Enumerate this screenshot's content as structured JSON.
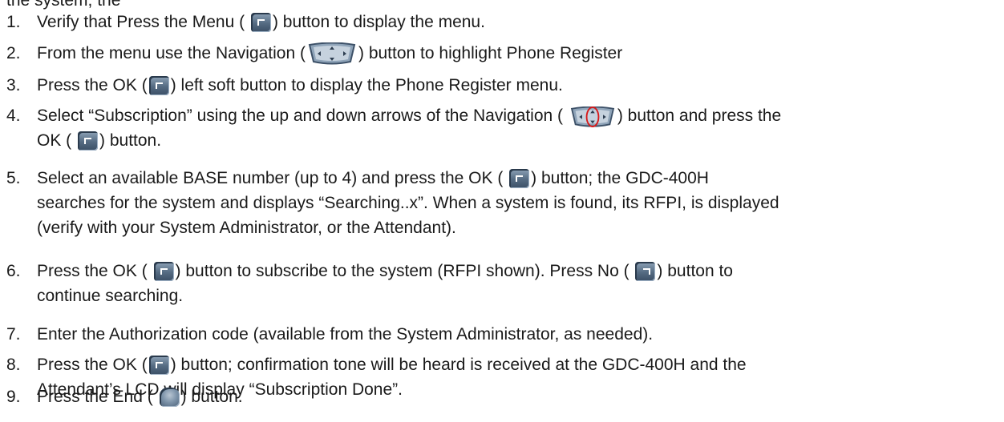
{
  "top_fragment": "the system, the",
  "steps": [
    {
      "num": "1.",
      "lines": [
        [
          {
            "t": "Verify that Press the Menu ( "
          },
          {
            "icon": "menu-key-icon"
          },
          {
            "t": ") button to display the menu."
          }
        ]
      ]
    },
    {
      "num": "2.",
      "lines": [
        [
          {
            "t": "From the menu use the Navigation ("
          },
          {
            "icon": "navigation-key-icon"
          },
          {
            "t": ") button to highlight Phone Register"
          }
        ]
      ]
    },
    {
      "num": "3.",
      "lines": [
        [
          {
            "t": "Press the OK ("
          },
          {
            "icon": "ok-key-icon"
          },
          {
            "t": ") left soft button to display the Phone Register menu."
          }
        ]
      ]
    },
    {
      "num": "4.",
      "lines": [
        [
          {
            "t": "Select “Subscription” using the up and down arrows of the Navigation ( "
          },
          {
            "icon": "navigation-updown-icon"
          },
          {
            "t": ") button and press the"
          }
        ],
        [
          {
            "t": "OK ( "
          },
          {
            "icon": "ok-key-icon"
          },
          {
            "t": ") button."
          }
        ]
      ]
    },
    {
      "num": "5.",
      "lines": [
        [
          {
            "t": "Select an available BASE number (up to 4) and press the OK ( "
          },
          {
            "icon": "ok-key-icon"
          },
          {
            "t": ") button; the GDC-400H"
          }
        ],
        [
          {
            "t": "searches for the system and displays “Searching..x”.  When a system is found, its RFPI, is displayed"
          }
        ],
        [
          {
            "t": "(verify with your System Administrator, or the Attendant)."
          }
        ]
      ]
    },
    {
      "num": "6.",
      "lines": [
        [
          {
            "t": "Press the OK ( "
          },
          {
            "icon": "ok-key-icon"
          },
          {
            "t": ") button to subscribe to the system (RFPI shown). Press No ( "
          },
          {
            "icon": "no-key-icon"
          },
          {
            "t": ") button to"
          }
        ],
        [
          {
            "t": "continue searching."
          }
        ]
      ]
    },
    {
      "num": "7.",
      "lines": [
        [
          {
            "t": "Enter the Authorization code (available from the System Administrator, as needed)."
          }
        ]
      ]
    },
    {
      "num": "8.",
      "lines": [
        [
          {
            "t": "Press the OK ("
          },
          {
            "icon": "ok-key-icon"
          },
          {
            "t": ") button; confirmation tone will be heard is received at the GDC-400H and the"
          }
        ],
        [
          {
            "t": "Attendant’s LCD will display “Subscription Done”."
          }
        ]
      ]
    },
    {
      "num": "9.",
      "lines": [
        [
          {
            "t": "Press the End ( "
          },
          {
            "icon": "end-key-icon"
          },
          {
            "t": ") button."
          }
        ]
      ]
    }
  ]
}
